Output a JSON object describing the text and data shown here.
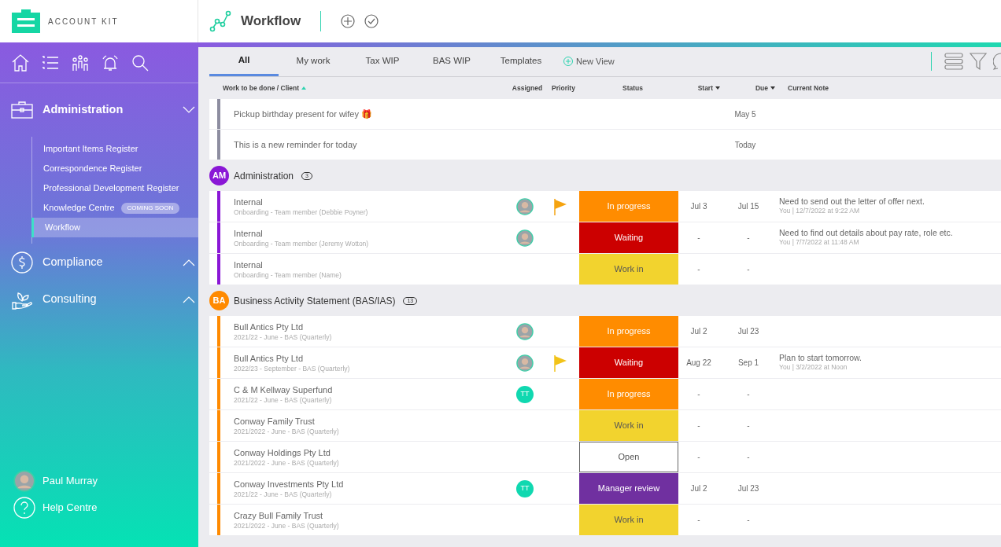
{
  "brand": {
    "name": "ACCOUNT KIT"
  },
  "header": {
    "title": "Workflow"
  },
  "sidebar": {
    "sections": [
      {
        "label": "Administration",
        "kind": "briefcase",
        "expanded": true,
        "items": [
          {
            "label": "Important Items Register",
            "selected": false
          },
          {
            "label": "Correspondence Register",
            "selected": false
          },
          {
            "label": "Professional Development Register",
            "selected": false
          },
          {
            "label": "Knowledge Centre",
            "badge": "COMING SOON",
            "selected": false
          },
          {
            "label": "Workflow",
            "selected": true
          }
        ]
      },
      {
        "label": "Compliance",
        "kind": "dollar",
        "expanded": false
      },
      {
        "label": "Consulting",
        "kind": "plant",
        "expanded": false
      }
    ],
    "user": "Paul Murray",
    "help": "Help Centre"
  },
  "tabs": [
    {
      "label": "All",
      "selected": true
    },
    {
      "label": "My work",
      "selected": false
    },
    {
      "label": "Tax WIP",
      "selected": false
    },
    {
      "label": "BAS WIP",
      "selected": false
    },
    {
      "label": "Templates",
      "selected": false
    }
  ],
  "new_view": "New View",
  "columns": [
    {
      "label": "Work to be done / Client",
      "kind": "ascending"
    },
    {
      "label": "Assigned",
      "kind": "plain"
    },
    {
      "label": "Priority",
      "kind": "plain"
    },
    {
      "label": "Status",
      "kind": "plain"
    },
    {
      "label": "Start",
      "kind": "descending"
    },
    {
      "label": "Due",
      "kind": "descending"
    },
    {
      "label": "Current Note",
      "kind": "plain"
    }
  ],
  "reminders": [
    {
      "title": "Pickup birthday present for wifey 🎁",
      "due": "May 5"
    },
    {
      "title": "This is a new reminder for today",
      "due": "Today"
    }
  ],
  "groups": [
    {
      "initials": "AM",
      "name": "Administration",
      "count": "3",
      "color": "#8a17d6",
      "rows": [
        {
          "title": "Internal",
          "subtitle": "Onboarding - Team member (Debbie Poyner)",
          "assignee": {
            "kind": "photo"
          },
          "priority": {
            "kind": "high"
          },
          "status": {
            "label": "In progress",
            "kind": "in_progress"
          },
          "start": "Jul 3",
          "due": "Jul 15",
          "note": "Need to send out the letter of offer next.",
          "note_meta": "You | 12/7/2022 at 9:22 AM"
        },
        {
          "title": "Internal",
          "subtitle": "Onboarding - Team member (Jeremy Wotton)",
          "assignee": {
            "kind": "photo"
          },
          "status": {
            "label": "Waiting",
            "kind": "waiting"
          },
          "start": "-",
          "due": "-",
          "note": "Need to find out details about pay rate, role etc.",
          "note_meta": "You | 7/7/2022 at 11:48 AM"
        },
        {
          "title": "Internal",
          "subtitle": "Onboarding - Team member (Name)",
          "status": {
            "label": "Work in",
            "kind": "work_in"
          },
          "start": "-",
          "due": "-"
        }
      ]
    },
    {
      "initials": "BA",
      "name": "Business Activity Statement (BAS/IAS)",
      "count": "13",
      "color": "#ff8a00",
      "rows": [
        {
          "title": "Bull Antics Pty Ltd",
          "subtitle": "2021/22 - June - BAS (Quarterly)",
          "assignee": {
            "kind": "photo"
          },
          "status": {
            "label": "In progress",
            "kind": "in_progress"
          },
          "start": "Jul 2",
          "due": "Jul 23"
        },
        {
          "title": "Bull Antics Pty Ltd",
          "subtitle": "2022/23 - September - BAS (Quarterly)",
          "assignee": {
            "kind": "photo"
          },
          "priority": {
            "kind": "medium"
          },
          "status": {
            "label": "Waiting",
            "kind": "waiting"
          },
          "start": "Aug 22",
          "due": "Sep 1",
          "note": "Plan to start tomorrow.",
          "note_meta": "You | 3/2/2022 at Noon"
        },
        {
          "title": "C & M Kellway Superfund",
          "subtitle": "2021/22 - June - BAS (Quarterly)",
          "assignee": {
            "kind": "initials",
            "initials": "TT"
          },
          "status": {
            "label": "In progress",
            "kind": "in_progress"
          },
          "start": "-",
          "due": "-"
        },
        {
          "title": "Conway Family Trust",
          "subtitle": "2021/2022 - June - BAS (Quarterly)",
          "status": {
            "label": "Work in",
            "kind": "work_in"
          },
          "start": "-",
          "due": "-"
        },
        {
          "title": "Conway Holdings Pty Ltd",
          "subtitle": "2021/2022 - June - BAS (Quarterly)",
          "status": {
            "label": "Open",
            "kind": "open"
          },
          "start": "-",
          "due": "-"
        },
        {
          "title": "Conway Investments Pty Ltd",
          "subtitle": "2021/22 - June - BAS (Quarterly)",
          "assignee": {
            "kind": "initials",
            "initials": "TT"
          },
          "status": {
            "label": "Manager review",
            "kind": "manager_review"
          },
          "start": "Jul 2",
          "due": "Jul 23"
        },
        {
          "title": "Crazy Bull Family Trust",
          "subtitle": "2021/2022 - June - BAS (Quarterly)",
          "status": {
            "label": "Work in",
            "kind": "work_in"
          },
          "start": "-",
          "due": "-"
        }
      ]
    }
  ]
}
